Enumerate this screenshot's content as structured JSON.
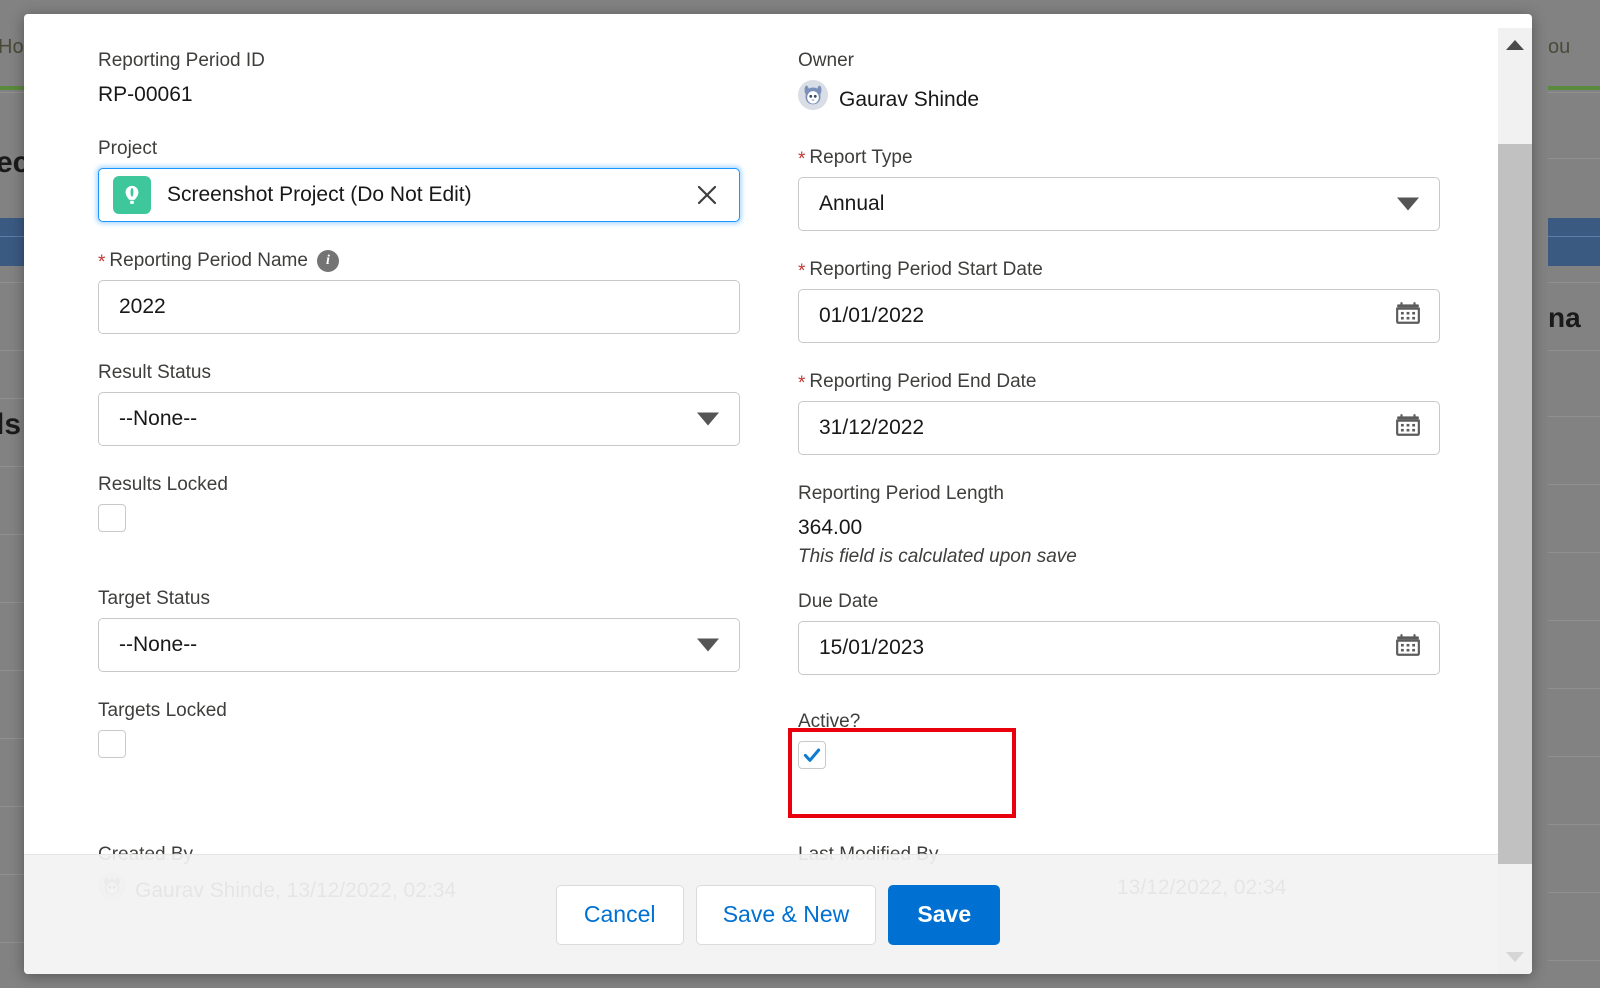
{
  "background": {
    "tab_label": "Hom",
    "tab_label_right": "ou",
    "record_text": "ec",
    "details_text": "ls",
    "related_text": "na"
  },
  "modal": {
    "left_column": [
      {
        "type": "static",
        "label": "Reporting Period ID",
        "value": "RP-00061",
        "required": false,
        "name": "reporting-period-id"
      },
      {
        "type": "lookup",
        "label": "Project",
        "value": "Screenshot Project (Do Not Edit)",
        "required": false,
        "icon": "hot-air-balloon-icon",
        "icon_color": "#3ec79a",
        "clear_icon": "close-icon",
        "name": "project"
      },
      {
        "type": "text",
        "label": "Reporting Period Name",
        "value": "2022",
        "required": true,
        "has_info": true,
        "info_icon": "info-icon",
        "name": "reporting-period-name"
      },
      {
        "type": "select",
        "label": "Result Status",
        "value": "--None--",
        "required": false,
        "name": "result-status"
      },
      {
        "type": "checkbox",
        "label": "Results Locked",
        "checked": false,
        "required": false,
        "name": "results-locked"
      },
      {
        "type": "select",
        "label": "Target Status",
        "value": "--None--",
        "required": false,
        "name": "target-status"
      },
      {
        "type": "checkbox",
        "label": "Targets Locked",
        "checked": false,
        "required": false,
        "name": "targets-locked"
      }
    ],
    "right_column": [
      {
        "type": "owner",
        "label": "Owner",
        "value": "Gaurav Shinde",
        "required": false,
        "avatar_icon": "user-avatar-icon",
        "name": "owner"
      },
      {
        "type": "select",
        "label": "Report Type",
        "value": "Annual",
        "required": true,
        "name": "report-type"
      },
      {
        "type": "date",
        "label": "Reporting Period Start Date",
        "value": "01/01/2022",
        "required": true,
        "calendar_icon": "calendar-icon",
        "name": "reporting-period-start-date"
      },
      {
        "type": "date",
        "label": "Reporting Period End Date",
        "value": "31/12/2022",
        "required": true,
        "calendar_icon": "calendar-icon",
        "name": "reporting-period-end-date"
      },
      {
        "type": "static",
        "label": "Reporting Period Length",
        "value": "364.00",
        "note": "This field is calculated upon save",
        "required": false,
        "name": "reporting-period-length"
      },
      {
        "type": "date",
        "label": "Due Date",
        "value": "15/01/2023",
        "required": false,
        "calendar_icon": "calendar-icon",
        "name": "due-date"
      },
      {
        "type": "checkbox",
        "label": "Active?",
        "checked": true,
        "required": false,
        "highlighted": true,
        "name": "active"
      }
    ],
    "meta": {
      "created_by_label": "Created By",
      "created_by_value": "Gaurav Shinde, 13/12/2022, 02:34",
      "last_modified_by_label": "Last Modified By",
      "last_modified_by_value": "13/12/2022, 02:34"
    },
    "footer": {
      "cancel_label": "Cancel",
      "save_new_label": "Save & New",
      "save_label": "Save"
    },
    "scrollbar": {
      "up_icon": "scroll-up-arrow-icon",
      "down_icon": "scroll-down-arrow-icon"
    }
  },
  "colors": {
    "primary": "#0070d2",
    "link": "#0070d2",
    "required_star": "#c23934",
    "highlight_box": "#e8000d",
    "project_icon": "#3ec79a",
    "focus_ring": "#1b96ff"
  }
}
